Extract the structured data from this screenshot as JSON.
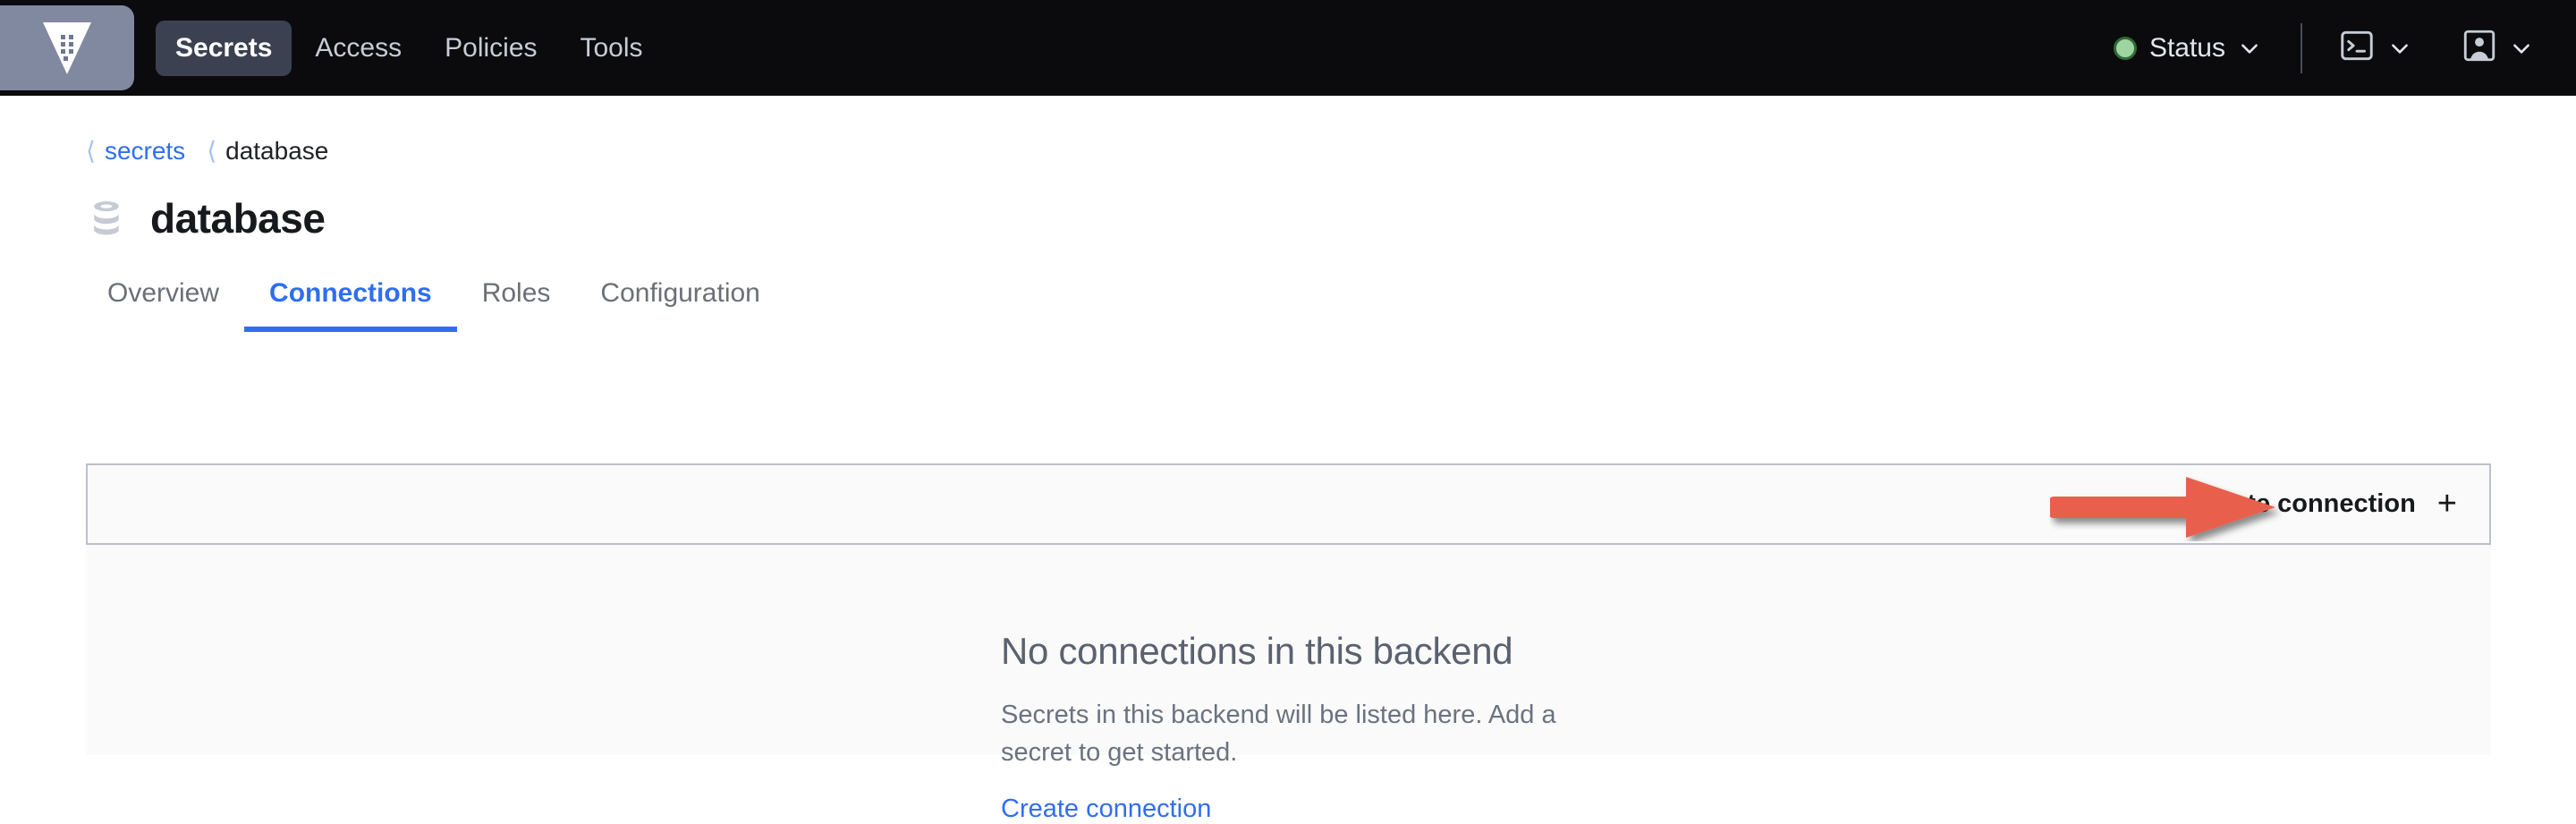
{
  "topnav": {
    "logo_icon": "vault-logo-icon",
    "links": [
      {
        "label": "Secrets",
        "active": true
      },
      {
        "label": "Access",
        "active": false
      },
      {
        "label": "Policies",
        "active": false
      },
      {
        "label": "Tools",
        "active": false
      }
    ],
    "status": {
      "label": "Status",
      "dot_color": "#9fd5a0",
      "dot_border_color": "#2e6b34",
      "chevron_icon": "chevron-down-icon"
    },
    "console_button": {
      "icon": "terminal-icon",
      "chevron_icon": "chevron-down-icon"
    },
    "user_button": {
      "icon": "user-avatar-icon",
      "chevron_icon": "chevron-down-icon"
    }
  },
  "breadcrumb": {
    "chevron_icon": "chevron-left-icon",
    "items": [
      {
        "label": "secrets",
        "link": true
      },
      {
        "label": "database",
        "link": false
      }
    ]
  },
  "header": {
    "icon": "database-stack-icon",
    "title": "database"
  },
  "tabs": [
    {
      "label": "Overview",
      "active": false
    },
    {
      "label": "Connections",
      "active": true
    },
    {
      "label": "Roles",
      "active": false
    },
    {
      "label": "Configuration",
      "active": false
    }
  ],
  "toolbar": {
    "create_label": "Create connection",
    "plus_icon": "plus-icon",
    "plus_glyph": "+"
  },
  "empty_state": {
    "title": "No connections in this backend",
    "body": "Secrets in this backend will be listed here. Add a secret to get started.",
    "link_label": "Create connection"
  },
  "annotation": {
    "arrow_color": "#e8604c",
    "target": "create-connection-button"
  },
  "colors": {
    "nav_background": "#0b0b0d",
    "nav_active_pill": "#3b4151",
    "accent_blue": "#2f6ef0",
    "panel_background": "#fafafa",
    "panel_border": "#bcc0cb",
    "logo_tile": "#8189a0"
  }
}
